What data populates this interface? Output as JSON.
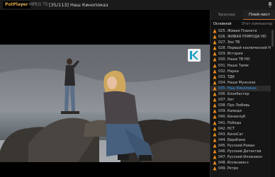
{
  "titlebar": {
    "app_name": "PotPlayer",
    "format": "MPEG TS",
    "title": "[35/113] Наш Кинопоказ"
  },
  "panel": {
    "tabs": [
      {
        "label": "Браузер",
        "active": false
      },
      {
        "label": "Плей-лист",
        "active": true
      }
    ],
    "subtabs": [
      {
        "label": "Основной",
        "active": true
      },
      {
        "label": "Этот компьютер",
        "active": false
      }
    ]
  },
  "playlist": [
    {
      "label": "025. Живая Планета",
      "active": false
    },
    {
      "label": "026. ЖИВАЯ ПРИРОДА HD",
      "active": false
    },
    {
      "label": "027. Зоо ТВ",
      "active": false
    },
    {
      "label": "028. Первый космический HD",
      "active": false
    },
    {
      "label": "029. История",
      "active": false
    },
    {
      "label": "030. Наше ТВ HD",
      "active": false
    },
    {
      "label": "031. Наше Тимм",
      "active": false
    },
    {
      "label": "032. Нарка",
      "active": false
    },
    {
      "label": "033. ТДК",
      "active": false
    },
    {
      "label": "034. Наше Мужское",
      "active": false
    },
    {
      "label": "035. Наш Кинопоказ",
      "active": true
    },
    {
      "label": "036. Блокбастер",
      "active": false
    },
    {
      "label": "037. Хит",
      "active": false
    },
    {
      "label": "038. Про Любовь",
      "active": false
    },
    {
      "label": "039. Камеди",
      "active": false
    },
    {
      "label": "040. Киноклуб",
      "active": false
    },
    {
      "label": "041. Победа",
      "active": false
    },
    {
      "label": "042. НСТ",
      "active": false
    },
    {
      "label": "043. КиноСат",
      "active": false
    },
    {
      "label": "044. ЕвроКино",
      "active": false
    },
    {
      "label": "045. Русский Роман",
      "active": false
    },
    {
      "label": "046. Русский Детектив",
      "active": false
    },
    {
      "label": "047. Русский Иллюзион",
      "active": false
    },
    {
      "label": "048. Иллюзион+",
      "active": false
    },
    {
      "label": "049. Ретро",
      "active": false
    }
  ],
  "colors": {
    "accent": "#c86a2a",
    "active_item": "#3aa0ff",
    "app_name": "#e0a84a"
  }
}
